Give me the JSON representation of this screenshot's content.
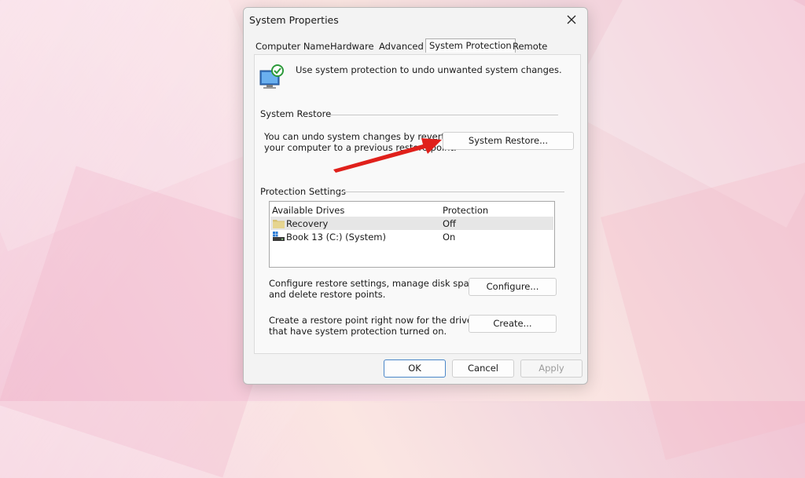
{
  "window": {
    "title": "System Properties"
  },
  "tabs": [
    {
      "label": "Computer Name",
      "active": false
    },
    {
      "label": "Hardware",
      "active": false
    },
    {
      "label": "Advanced",
      "active": false
    },
    {
      "label": "System Protection",
      "active": true
    },
    {
      "label": "Remote",
      "active": false
    }
  ],
  "intro_text": "Use system protection to undo unwanted system changes.",
  "system_restore": {
    "group_label": "System Restore",
    "description_line1": "You can undo system changes by reverting",
    "description_line2": "your computer to a previous restore point.",
    "button_label": "System Restore..."
  },
  "protection_settings": {
    "group_label": "Protection Settings",
    "columns": [
      "Available Drives",
      "Protection"
    ],
    "drives": [
      {
        "name": "Recovery",
        "protection": "Off",
        "icon": "folder-icon",
        "selected": true
      },
      {
        "name": "Book 13 (C:) (System)",
        "protection": "On",
        "icon": "system-drive-icon",
        "selected": false
      }
    ],
    "configure_text_line1": "Configure restore settings, manage disk space,",
    "configure_text_line2": "and delete restore points.",
    "configure_button": "Configure...",
    "create_text_line1": "Create a restore point right now for the drives",
    "create_text_line2": "that have system protection turned on.",
    "create_button": "Create..."
  },
  "footer": {
    "ok": "OK",
    "cancel": "Cancel",
    "apply": "Apply"
  },
  "colors": {
    "accent_border": "#4a87c8",
    "annotation_arrow": "#e0201b"
  }
}
